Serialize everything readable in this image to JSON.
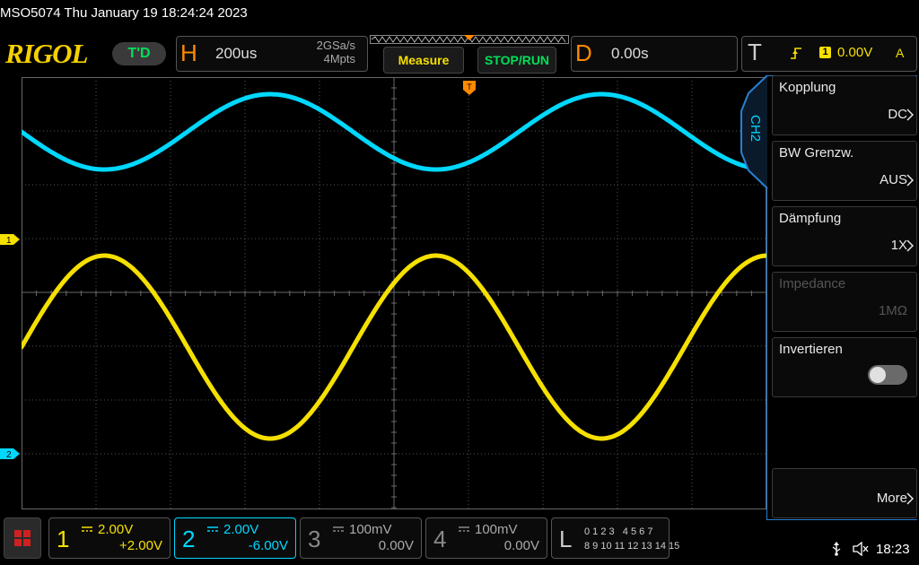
{
  "title": "MSO5074  Thu January 19 18:24:24 2023",
  "brand": "RIGOL",
  "trigger_status": "T'D",
  "horizontal": {
    "letter": "H",
    "timebase": "200us",
    "sample_rate": "2GSa/s",
    "memory_depth": "4Mpts"
  },
  "buttons": {
    "measure": "Measure",
    "stop_run": "STOP/RUN"
  },
  "delay": {
    "letter": "D",
    "value": "0.00s"
  },
  "trigger": {
    "letter": "T",
    "source": "1",
    "level": "0.00V",
    "mode": "A"
  },
  "waveforms": {
    "ch1": {
      "amplitude_div": 1.7,
      "center_div": -1.0,
      "period_div": 4.45,
      "zero_cross_x_div": 0.0
    },
    "ch2": {
      "amplitude_div": 0.7,
      "center_div": 3.0,
      "period_div": 4.45
    }
  },
  "channel_markers": {
    "ch1": "1",
    "ch2": "2"
  },
  "menu": {
    "channel_tab": "CH2",
    "items": [
      {
        "title": "Kopplung",
        "value": "DC"
      },
      {
        "title": "BW Grenzw.",
        "value": "AUS"
      },
      {
        "title": "Dämpfung",
        "value": "1X"
      },
      {
        "title": "Impedance",
        "value": "1MΩ"
      },
      {
        "title": "Invertieren",
        "value": ""
      },
      {
        "title": "",
        "value": "More"
      }
    ]
  },
  "channels": [
    {
      "num": "1",
      "scale": "2.00V",
      "offset": "+2.00V",
      "color": "#f5e000"
    },
    {
      "num": "2",
      "scale": "2.00V",
      "offset": "-6.00V",
      "color": "#00d8ff"
    },
    {
      "num": "3",
      "scale": "100mV",
      "offset": "0.00V",
      "color": "#777777"
    },
    {
      "num": "4",
      "scale": "100mV",
      "offset": "0.00V",
      "color": "#777777"
    }
  ],
  "logic": {
    "letter": "L",
    "row1": "0 1 2 3   4 5 6 7",
    "row2": "8 9 10 11 12 13 14 15"
  },
  "status": {
    "time": "18:23"
  },
  "colors": {
    "ch1": "#f5e000",
    "ch2": "#00d8ff",
    "accent": "#ff8a00",
    "run": "#00e05a"
  }
}
